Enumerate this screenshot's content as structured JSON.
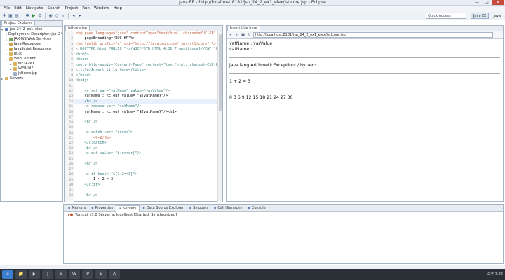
{
  "window": {
    "title": "Java EE - http://localhost:8181/jsp_24_2_ex1_elex/jstlcore.jsp - Eclipse",
    "minimize": "—",
    "maximize": "□",
    "close": "✕"
  },
  "menu": [
    "File",
    "Edit",
    "Navigate",
    "Search",
    "Project",
    "Run",
    "Window",
    "Help"
  ],
  "toolbar": {
    "quick_access": "Quick Access",
    "perspectives": [
      "Java EE",
      "Java"
    ]
  },
  "explorer": {
    "tab": "Project Explorer",
    "items": [
      {
        "label": "jsp_24_2_ex1_elex",
        "color": "#5b7fb4"
      },
      {
        "label": "Deployment Descriptor: jsp_24",
        "color": "#7aa35a"
      },
      {
        "label": "JAX-WS Web Services",
        "color": "#7aa35a"
      },
      {
        "label": "Java Resources",
        "color": "#c9a24a"
      },
      {
        "label": "JavaScript Resources",
        "color": "#c9a24a"
      },
      {
        "label": "build",
        "color": "#d9b45a"
      },
      {
        "label": "WebContent",
        "color": "#d9b45a"
      },
      {
        "label": "META-INF",
        "color": "#d9b45a"
      },
      {
        "label": "WEB-INF",
        "color": "#d9b45a"
      },
      {
        "label": "jstlcore.jsp",
        "color": "#9ab0c8"
      },
      {
        "label": "Servers",
        "color": "#d9b45a"
      }
    ]
  },
  "editor": {
    "tab": "jstlcore.jsp",
    "lines": [
      {
        "n": "1",
        "t": "<%@ page language=\"java\" contentType=\"text/html; charset=EUC-KR\""
      },
      {
        "n": "2",
        "t": "    pageEncoding=\"EUC-KR\"%>"
      },
      {
        "n": "3",
        "t": "<%@ taglib prefix=\"c\" uri=\"http://java.sun.com/jsp/jstl/core\" %>"
      },
      {
        "n": "4",
        "t": "<!DOCTYPE html PUBLIC \"-//W3C//DTD HTML 4.01 Transitional//EN\" \"http"
      },
      {
        "n": "5",
        "t": "<html>"
      },
      {
        "n": "6",
        "t": "<head>"
      },
      {
        "n": "7",
        "t": "<meta http-equiv=\"Content-Type\" content=\"text/html; charset=EUC-KR\""
      },
      {
        "n": "8",
        "t": "<title>Insert title here</title>"
      },
      {
        "n": "9",
        "t": "</head>"
      },
      {
        "n": "10",
        "t": "<body>"
      },
      {
        "n": "11",
        "t": ""
      },
      {
        "n": "12",
        "t": "    <c:set var=\"vatName\" value=\"varValue\"/>"
      },
      {
        "n": "13",
        "t": "    vatName : <c:out value= \"${vatName}\"/>"
      },
      {
        "n": "14",
        "t": "    <br />"
      },
      {
        "n": "15",
        "t": "    <c:remove var= \"vatName\"/>"
      },
      {
        "n": "16",
        "t": "    vatName : <c:out value= \"${vatName}\"/><h3>"
      },
      {
        "n": "17",
        "t": ""
      },
      {
        "n": "18",
        "t": "    <hr />"
      },
      {
        "n": "19",
        "t": ""
      },
      {
        "n": "20",
        "t": "    <c:catch var= \"error\">"
      },
      {
        "n": "21",
        "t": "        <%=2/0%>"
      },
      {
        "n": "22",
        "t": "    </c:catch>"
      },
      {
        "n": "23",
        "t": "    <br />"
      },
      {
        "n": "24",
        "t": "    <c:out value= \"${error}\"/>"
      },
      {
        "n": "25",
        "t": ""
      },
      {
        "n": "26",
        "t": "    <hr />"
      },
      {
        "n": "27",
        "t": ""
      },
      {
        "n": "28",
        "t": "    <c:if test= \"${1+2==3}\">"
      },
      {
        "n": "29",
        "t": "        1 + 2 = 3"
      },
      {
        "n": "30",
        "t": "    </c:if>"
      },
      {
        "n": "31",
        "t": ""
      },
      {
        "n": "32",
        "t": "    <hr />"
      }
    ]
  },
  "browser": {
    "tab": "Insert title here",
    "url": "http://localhost:8181/jsp_24_2_ex1_elex/jstlcore.jsp",
    "output": [
      "vatName : varValue",
      "vatName :",
      "java.lang.ArithmeticException: / by zero",
      "1 + 2 = 3",
      "0 3 6 9 12 15 18 21 24 27 30"
    ]
  },
  "bottom": {
    "tabs": [
      "Markers",
      "Properties",
      "Servers",
      "Data Source Explorer",
      "Snippets",
      "Call Hierarchy",
      "Console"
    ],
    "server_row": "Tomcat v7.0 Server at localhost [Started, Synchronized]"
  },
  "taskbar": {
    "items": [
      "e",
      "📁",
      "▶",
      "J",
      "S",
      "W",
      "P",
      "E",
      "A"
    ],
    "clock": "오후 7:22"
  }
}
